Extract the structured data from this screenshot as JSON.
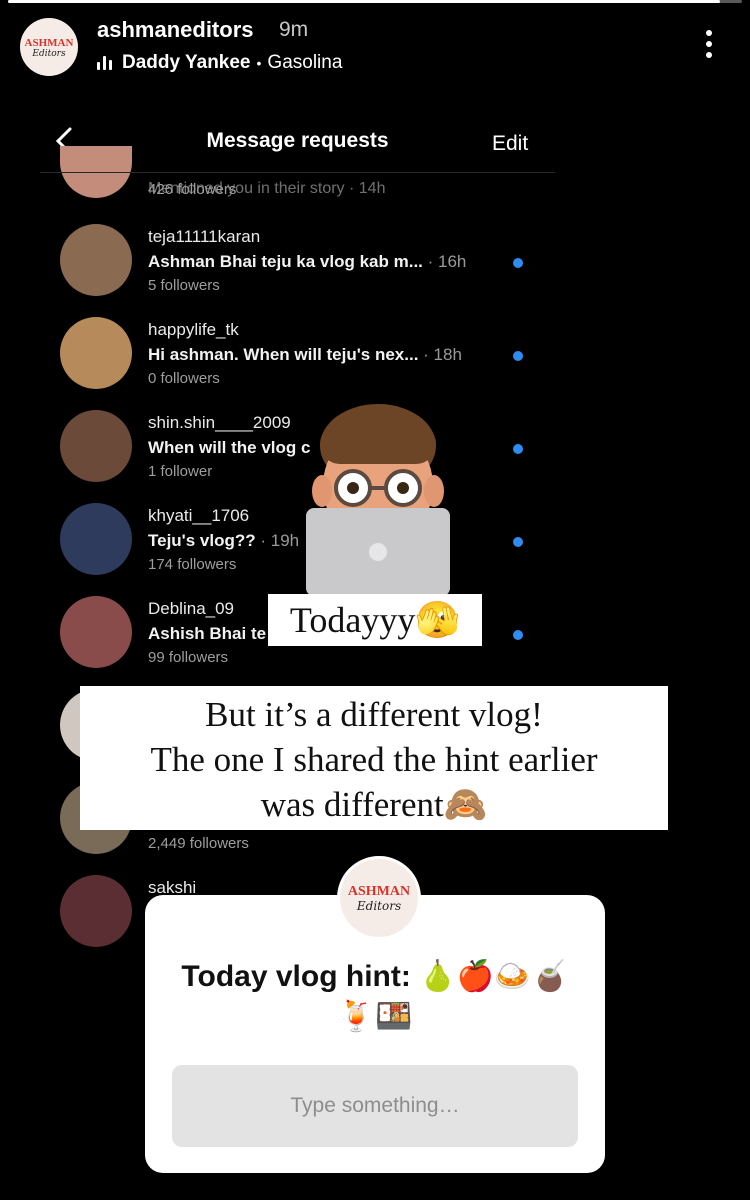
{
  "story": {
    "username": "ashmaneditors",
    "time": "9m",
    "music_artist": "Daddy Yankee",
    "music_separator": "•",
    "music_track": "Gasolina",
    "progress": 0.97,
    "logo_line1": "ASHMAN",
    "logo_line2": "Editors",
    "more_icon": "more-vertical-icon"
  },
  "screenshot": {
    "back_icon": "chevron-left-icon",
    "title": "Message requests",
    "edit": "Edit",
    "partial_row": {
      "message": "Mentioned you in their story · 14h",
      "followers": "426 followers"
    },
    "rows": [
      {
        "name": "teja11111karan",
        "message": "Ashman Bhai teju ka vlog kab m...",
        "ago": "· 16h",
        "followers": "5 followers",
        "unread": true,
        "avatar_color": "#8a6b52"
      },
      {
        "name": "happylife_tk",
        "message": "Hi ashman. When will teju's nex...",
        "ago": "· 18h",
        "followers": "0 followers",
        "unread": true,
        "avatar_color": "#b68a5a"
      },
      {
        "name": "shin.shin____2009",
        "message": "When will the vlog c",
        "ago": "",
        "followers": "1 follower",
        "unread": true,
        "avatar_color": "#6b4a3a"
      },
      {
        "name": "khyati__1706",
        "message": "Teju's vlog??",
        "ago": "· 19h",
        "followers": "174 followers",
        "unread": true,
        "avatar_color": "#2f3b5c"
      },
      {
        "name": "Deblina_09",
        "message": "Ashish Bhai te",
        "ago": "",
        "followers": "99 followers",
        "unread": true,
        "avatar_color": "#8a4b4b"
      },
      {
        "name": "",
        "message": "",
        "ago": "",
        "followers": "",
        "unread": false,
        "avatar_color": "#cfc7c0"
      },
      {
        "name": "",
        "message": "",
        "ago": "",
        "followers": "2,449 followers",
        "unread": false,
        "avatar_color": "#7a6a58"
      },
      {
        "name": "sakshi",
        "message": "",
        "ago": "",
        "followers": "",
        "unread": false,
        "avatar_color": "#5a2e32"
      }
    ]
  },
  "stickers": {
    "today": "Todayyy🫣",
    "caption_line1": "But it’s a different vlog!",
    "caption_line2": "The one I shared the hint earlier",
    "caption_line3": "was different🙈"
  },
  "question": {
    "prompt": "Today vlog hint: 🍐🍎🍛🧉🍹🍱",
    "placeholder": "Type something…"
  }
}
